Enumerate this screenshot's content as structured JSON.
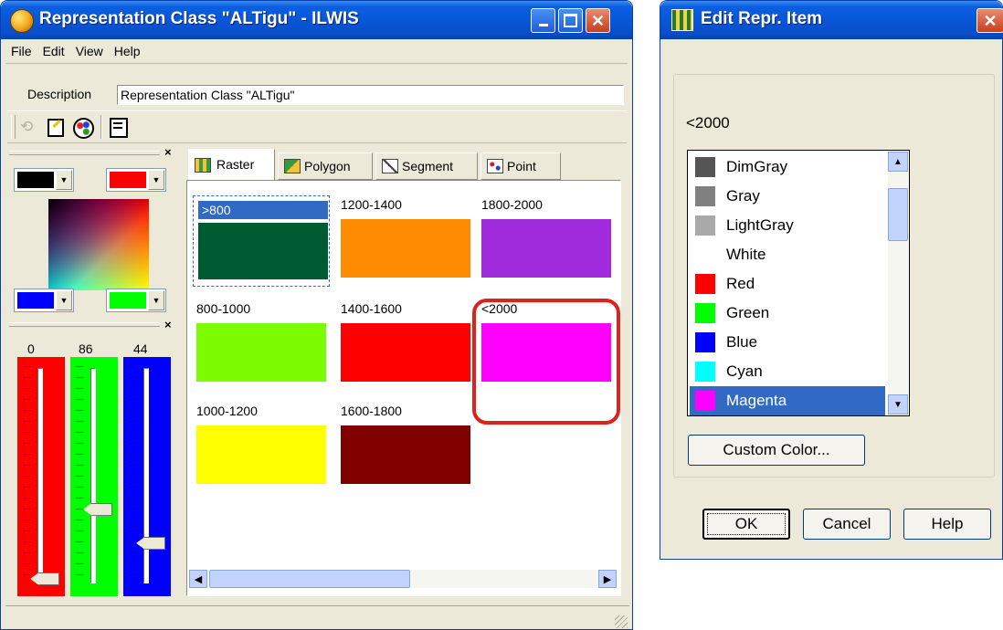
{
  "main_window": {
    "title": "Representation Class \"ALTigu\" - ILWIS",
    "menu": [
      "File",
      "Edit",
      "View",
      "Help"
    ],
    "description_label": "Description",
    "description_value": "Representation Class \"ALTigu\"",
    "tabs": [
      "Raster",
      "Polygon",
      "Segment",
      "Point"
    ],
    "active_tab": "Raster",
    "classes": [
      {
        "label": ">800",
        "color": "#005a32",
        "selected": true
      },
      {
        "label": "1200-1400",
        "color": "#ff8c00"
      },
      {
        "label": "1800-2000",
        "color": "#a02bdc"
      },
      {
        "label": "800-1000",
        "color": "#7cfc00"
      },
      {
        "label": "1400-1600",
        "color": "#ff0000"
      },
      {
        "label": "<2000",
        "color": "#ff00ff",
        "highlighted": true
      },
      {
        "label": "1000-1200",
        "color": "#ffff00"
      },
      {
        "label": "1600-1800",
        "color": "#800000"
      }
    ],
    "color_picker": {
      "top_left": "#000000",
      "top_right": "#ff0000",
      "bottom_left": "#0000ff",
      "bottom_right": "#00ff00"
    },
    "sliders": {
      "red": {
        "value": "0",
        "fraction": 0.0,
        "color": "#ff0000"
      },
      "green": {
        "value": "86",
        "fraction": 0.337,
        "color": "#00ff00"
      },
      "blue": {
        "value": "44",
        "fraction": 0.173,
        "color": "#0000ff"
      }
    }
  },
  "dialog": {
    "title": "Edit Repr. Item",
    "item_label": "<2000",
    "colors": [
      {
        "name": "DimGray",
        "color": "#555555"
      },
      {
        "name": "Gray",
        "color": "#808080"
      },
      {
        "name": "LightGray",
        "color": "#a9a9a9"
      },
      {
        "name": "White",
        "color": "#ffffff"
      },
      {
        "name": "Red",
        "color": "#ff0000"
      },
      {
        "name": "Green",
        "color": "#00ff00"
      },
      {
        "name": "Blue",
        "color": "#0000ff"
      },
      {
        "name": "Cyan",
        "color": "#00ffff"
      },
      {
        "name": "Magenta",
        "color": "#ff00ff",
        "selected": true
      }
    ],
    "custom_color_label": "Custom Color...",
    "ok_label": "OK",
    "cancel_label": "Cancel",
    "help_label": "Help"
  },
  "colors": {
    "title_bar": "#0856d6",
    "selection": "#316ac5",
    "highlight_ring": "#e0201a"
  }
}
